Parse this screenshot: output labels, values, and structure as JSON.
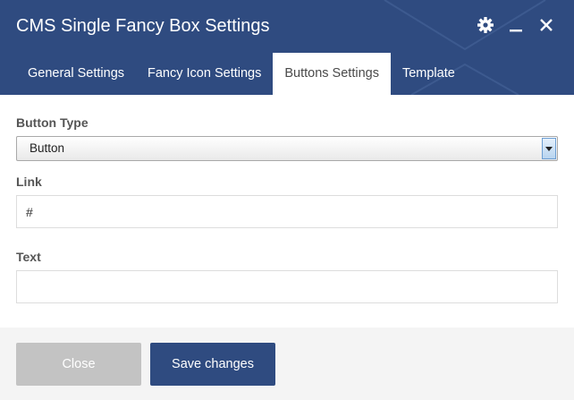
{
  "dialog": {
    "title": "CMS Single Fancy Box Settings"
  },
  "header_icons": [
    "gear-icon",
    "minimize-icon",
    "close-icon"
  ],
  "tabs": [
    {
      "label": "General Settings",
      "active": false
    },
    {
      "label": "Fancy Icon Settings",
      "active": false
    },
    {
      "label": "Buttons Settings",
      "active": true
    },
    {
      "label": "Template",
      "active": false
    }
  ],
  "form": {
    "button_type": {
      "label": "Button Type",
      "value": "Button"
    },
    "link": {
      "label": "Link",
      "value": "#"
    },
    "text": {
      "label": "Text",
      "value": ""
    }
  },
  "footer": {
    "close_label": "Close",
    "save_label": "Save changes"
  },
  "colors": {
    "header_bg": "#2f4b80",
    "primary_button": "#2f4b80",
    "disabled_button": "#c3c3c3",
    "footer_bg": "#f4f4f4"
  }
}
